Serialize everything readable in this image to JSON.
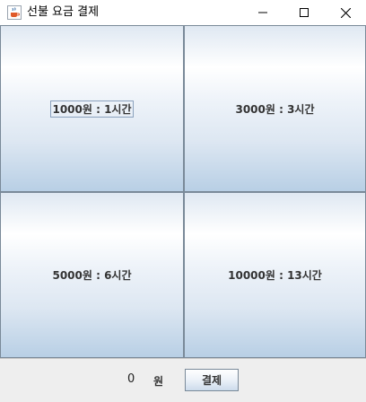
{
  "window": {
    "title": "선불 요금 결제",
    "icon": "java-cup-icon"
  },
  "options": [
    {
      "label": "1000원 : 1시간"
    },
    {
      "label": "3000원 : 3시간"
    },
    {
      "label": "5000원 : 6시간"
    },
    {
      "label": "10000원 : 13시간"
    }
  ],
  "footer": {
    "amount": "0",
    "unit": "원",
    "pay_label": "결제"
  }
}
